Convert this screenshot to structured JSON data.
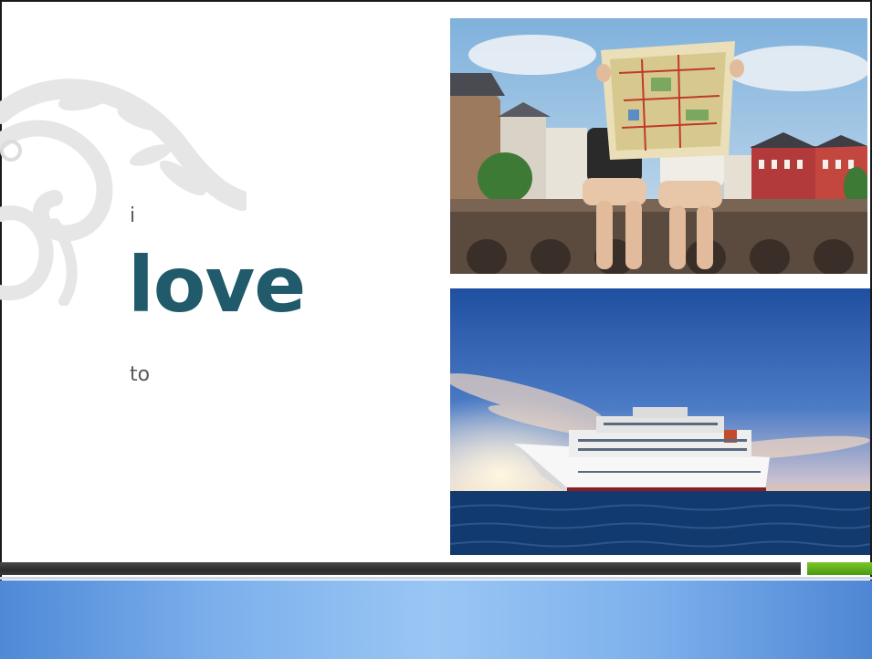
{
  "slide": {
    "word_i": "i",
    "word_love": "love",
    "word_to": "to"
  },
  "colors": {
    "accent_text": "#215a6a",
    "body_text": "#595959",
    "accent_green": "#4a9a10",
    "footer_blue": "#7cb0ec"
  },
  "images": {
    "top": "map-reading-travelers-photo",
    "bottom": "cruise-ship-at-sunset-photo"
  },
  "decoration": "floral-swirl-ornament"
}
